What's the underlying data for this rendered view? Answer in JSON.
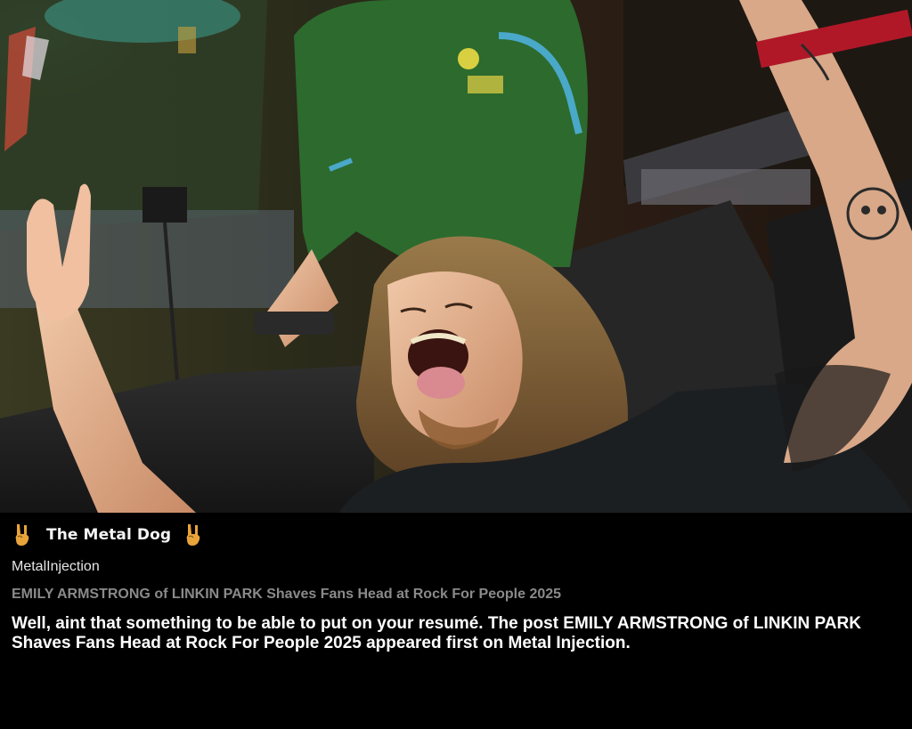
{
  "feed": {
    "title": "The Metal Dog",
    "icon_left": "rock-horns-icon",
    "icon_right": "rock-horns-icon",
    "icon_color": "#e8a43a"
  },
  "post": {
    "source": "MetalInjection",
    "headline": "EMILY ARMSTRONG of LINKIN PARK Shaves Fans Head at Rock For People 2025",
    "body": "Well, aint that something to be able to put on your resumé. The post EMILY ARMSTRONG of LINKIN PARK Shaves Fans Head at Rock For People 2025 appeared first on Metal Injection."
  },
  "colors": {
    "background": "#000000",
    "headline": "#8a8a8a",
    "body": "#ffffff"
  }
}
